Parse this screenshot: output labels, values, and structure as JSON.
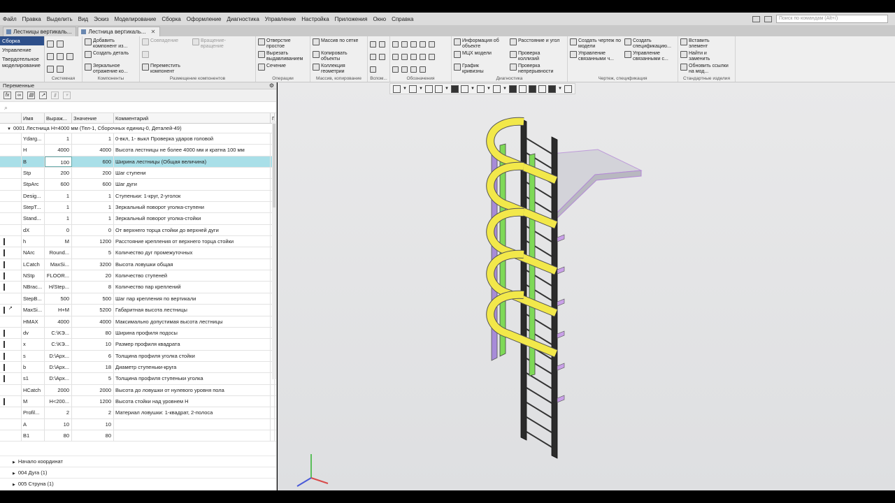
{
  "menubar": {
    "items": [
      "Файл",
      "Правка",
      "Выделить",
      "Вид",
      "Эскиз",
      "Моделирование",
      "Сборка",
      "Оформление",
      "Диагностика",
      "Управление",
      "Настройка",
      "Приложения",
      "Окно",
      "Справка"
    ],
    "search_placeholder": "Поиск по командам (Alt+/)"
  },
  "tabs": [
    {
      "label": "Лестницы вертикаль...",
      "active": false
    },
    {
      "label": "Лестница вертикаль...",
      "active": true
    }
  ],
  "ribbon": {
    "modes": [
      "Сборка",
      "Управление",
      "Твердотельное моделирование"
    ],
    "system": {
      "caption": "Системная"
    },
    "components": {
      "caption": "Компоненты",
      "add": "Добавить компонент из...",
      "create": "Создать деталь",
      "mirror": "Зеркальное отражение ко..."
    },
    "placement": {
      "caption": "Размещение компонентов",
      "coincide": "Совпадение",
      "rotate": "Вращение-вращение",
      "move": "Переместить компонент"
    },
    "operations": {
      "caption": "Операции",
      "hole": "Отверстие простое",
      "cut": "Вырезать выдавливанием",
      "section": "Сечение"
    },
    "array": {
      "caption": "Массив, копирование",
      "grid": "Массив по сетке",
      "copy": "Копировать объекты",
      "collection": "Коллекция геометрии"
    },
    "aux": {
      "caption": "Вспом..."
    },
    "designations": {
      "caption": "Обозначения"
    },
    "diagnostics": {
      "caption": "Диагностика",
      "info": "Информация об объекте",
      "mcx": "МЦХ модели",
      "curvature": "График кривизны",
      "distance": "Расстояние и угол",
      "collisions": "Проверка коллизий",
      "continuity": "Проверка непрерывности"
    },
    "drawing": {
      "caption": "Чертеж, спецификация",
      "create_drawing": "Создать чертеж по модели",
      "manage_related": "Управление связанными ч...",
      "create_spec": "Создать спецификацию...",
      "manage_spec": "Управление связанными с..."
    },
    "standard": {
      "caption": "Стандартные изделия",
      "insert": "Вставить элемент",
      "find": "Найти и заменить",
      "update": "Обновить ссылки на мод..."
    }
  },
  "variables_panel": {
    "title": "Переменные",
    "columns": [
      "Имя",
      "Выраж...",
      "Значение",
      "Комментарий",
      "П"
    ],
    "group": "0001 Лестница H=4000 мм (Тел-1, Сборочных единиц-0, Деталей-49)",
    "rows": [
      {
        "name": "Ydarg...",
        "expr": "1",
        "value": "1",
        "comment": "0-вкл, 1- выкл Проверка ударов головой",
        "ext": false
      },
      {
        "name": "H",
        "expr": "4000",
        "value": "4000",
        "comment": "Высота лестницы не более 4000 мм и кратна 100 мм",
        "ext": false
      },
      {
        "name": "B",
        "expr": "100",
        "value": "600",
        "comment": "Ширина лестницы (Общая величина)",
        "ext": false
      },
      {
        "name": "Stp",
        "expr": "200",
        "value": "200",
        "comment": "Шаг ступени",
        "ext": false
      },
      {
        "name": "StpArc",
        "expr": "600",
        "value": "600",
        "comment": "Шаг дуги",
        "ext": false
      },
      {
        "name": "Desig...",
        "expr": "1",
        "value": "1",
        "comment": "Ступеньки: 1-круг, 2-уголок",
        "ext": false
      },
      {
        "name": "StepT...",
        "expr": "1",
        "value": "1",
        "comment": "Зеркальный поворот уголка-ступени",
        "ext": false
      },
      {
        "name": "Stand...",
        "expr": "1",
        "value": "1",
        "comment": "Зеркальный поворот уголка-стойки",
        "ext": false
      },
      {
        "name": "dX",
        "expr": "0",
        "value": "0",
        "comment": "От верхнего торца стойки до верхней дуги",
        "ext": false
      },
      {
        "name": "h",
        "expr": "M",
        "value": "1200",
        "comment": "Расстояние крепления от верхнего торца стойки",
        "ext": true
      },
      {
        "name": "NArc",
        "expr": "Round...",
        "value": "5",
        "comment": "Количество дуг промежуточных",
        "ext": true
      },
      {
        "name": "LCatch",
        "expr": "MaxSi...",
        "value": "3200",
        "comment": "Высота ловушки общая",
        "ext": true
      },
      {
        "name": "NStp",
        "expr": "FLOOR...",
        "value": "20",
        "comment": "Количество ступеней",
        "ext": true
      },
      {
        "name": "NBrac...",
        "expr": "H/Step...",
        "value": "8",
        "comment": "Количество пар креплений",
        "ext": true
      },
      {
        "name": "StepB...",
        "expr": "500",
        "value": "500",
        "comment": "Шаг пар крепления по вертикали",
        "ext": false
      },
      {
        "name": "MaxSi...",
        "expr": "H+M",
        "value": "5200",
        "comment": "Габаритная высота лестницы",
        "ext": true,
        "dep": true
      },
      {
        "name": "HMAX",
        "expr": "4000",
        "value": "4000",
        "comment": "Максимально допустимая высота лестницы",
        "ext": false
      },
      {
        "name": "dv",
        "expr": "C:\\КЭ...",
        "value": "80",
        "comment": "Ширина профиля подосы",
        "ext": true
      },
      {
        "name": "x",
        "expr": "C:\\КЭ...",
        "value": "10",
        "comment": "Размер профиля квадрата",
        "ext": true
      },
      {
        "name": "s",
        "expr": "D:\\Арх...",
        "value": "6",
        "comment": "Толщина профиля уголка стойки",
        "ext": true
      },
      {
        "name": "b",
        "expr": "D:\\Арх...",
        "value": "18",
        "comment": "Диаметр ступеньки-круга",
        "ext": true
      },
      {
        "name": "s1",
        "expr": "D:\\Арх...",
        "value": "5",
        "comment": "Толщина профиля ступеньки уголка",
        "ext": true
      },
      {
        "name": "HCatch",
        "expr": "2000",
        "value": "2000",
        "comment": "Высота до ловушки от нулевого уровня пола",
        "ext": false
      },
      {
        "name": "M",
        "expr": "H<200...",
        "value": "1200",
        "comment": "Высота стойки над уровнем H",
        "ext": true
      },
      {
        "name": "Profil...",
        "expr": "2",
        "value": "2",
        "comment": "Материал ловушки: 1-квадрат, 2-полоса",
        "ext": false
      },
      {
        "name": "A",
        "expr": "10",
        "value": "10",
        "comment": "",
        "ext": false
      },
      {
        "name": "B1",
        "expr": "80",
        "value": "80",
        "comment": "",
        "ext": false
      }
    ],
    "tree": [
      "Начало координат",
      "004 Дуга (1)",
      "005 Струна (1)"
    ]
  },
  "colors": {
    "accent": "#2d4f8a",
    "selection": "#a9dfe8",
    "hoop": "#f2e84a",
    "rail_green": "#7ed957",
    "rail_purple": "#a78bd8",
    "steel": "#2b2b2b"
  }
}
